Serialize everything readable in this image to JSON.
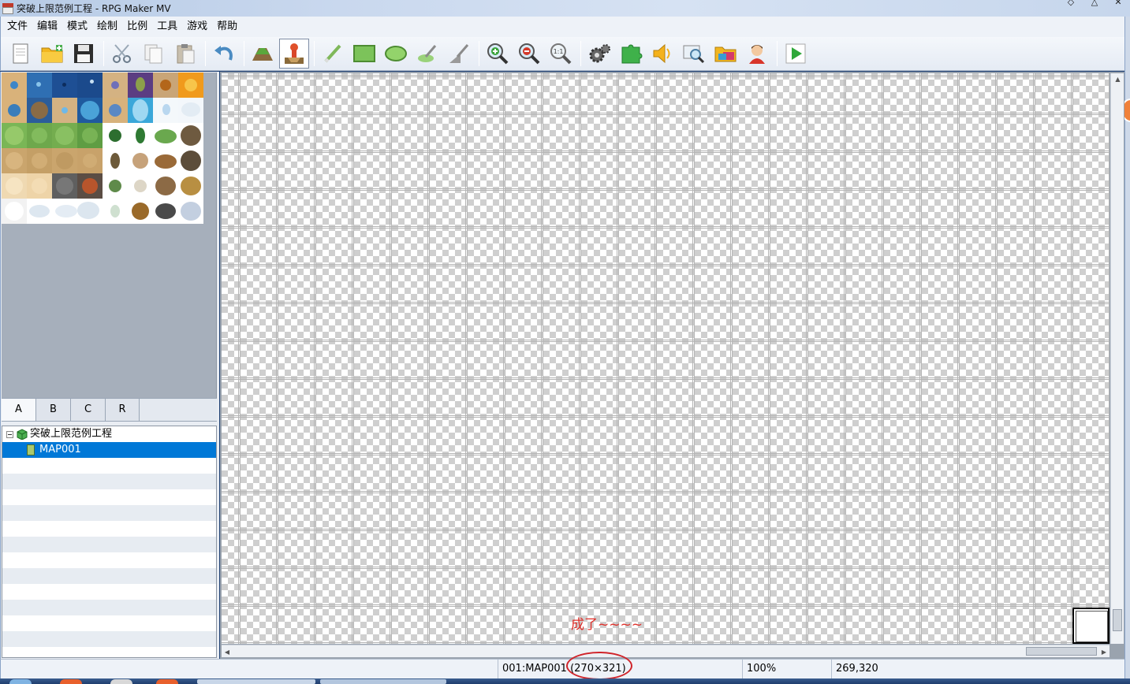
{
  "window": {
    "title": "突破上限范例工程 - RPG Maker MV"
  },
  "menu": [
    "文件",
    "编辑",
    "模式",
    "绘制",
    "比例",
    "工具",
    "游戏",
    "帮助"
  ],
  "toolbar": [
    {
      "icon": "new-project-icon"
    },
    {
      "icon": "open-project-icon"
    },
    {
      "icon": "save-project-icon"
    },
    {
      "sep": true
    },
    {
      "icon": "cut-icon"
    },
    {
      "icon": "copy-icon"
    },
    {
      "icon": "paste-icon"
    },
    {
      "sep": true
    },
    {
      "icon": "undo-icon"
    },
    {
      "sep": true
    },
    {
      "icon": "map-mode-icon"
    },
    {
      "icon": "event-mode-icon",
      "active": true
    },
    {
      "sep": true
    },
    {
      "icon": "pencil-icon"
    },
    {
      "icon": "rectangle-icon"
    },
    {
      "icon": "ellipse-icon"
    },
    {
      "icon": "fill-icon"
    },
    {
      "icon": "shadow-pen-icon"
    },
    {
      "sep": true
    },
    {
      "icon": "zoom-in-icon"
    },
    {
      "icon": "zoom-out-icon"
    },
    {
      "icon": "actual-size-icon"
    },
    {
      "sep": true
    },
    {
      "icon": "database-icon"
    },
    {
      "icon": "plugin-manager-icon"
    },
    {
      "icon": "sound-test-icon"
    },
    {
      "icon": "event-searcher-icon"
    },
    {
      "icon": "resource-manager-icon"
    },
    {
      "icon": "character-generator-icon"
    },
    {
      "sep": true
    },
    {
      "icon": "playtest-icon"
    }
  ],
  "toolbar_icon_text": {
    "actual_size": "1:1"
  },
  "tileset_tabs": [
    {
      "label": "A",
      "active": true
    },
    {
      "label": "B"
    },
    {
      "label": "C"
    },
    {
      "label": "R"
    }
  ],
  "map_tree": {
    "project": "突破上限范例工程",
    "maps": [
      {
        "label": "MAP001",
        "selected": true
      }
    ]
  },
  "map": {
    "annotation": "成了~~~~"
  },
  "status": {
    "map_info": "001:MAP001 (270×321)",
    "zoom": "100%",
    "coords": "269,320"
  },
  "colors": {
    "selection": "#0078d7",
    "annotation": "#e0302a"
  }
}
